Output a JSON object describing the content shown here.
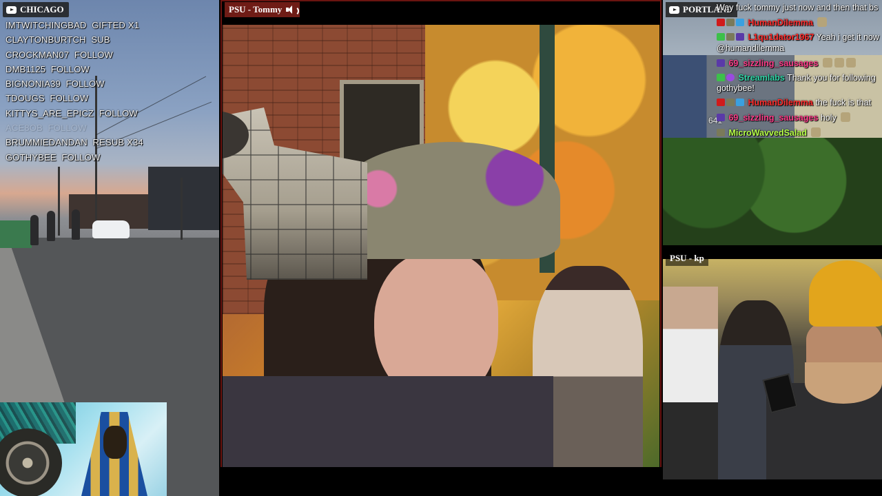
{
  "left": {
    "tag": "CHICAGO",
    "events": [
      {
        "user": "IMTWITCHINGBAD",
        "action": "GIFTED X1",
        "style": "normal"
      },
      {
        "user": "CLAYTONBURTCH",
        "action": "SUB",
        "style": "normal"
      },
      {
        "user": "CROCKMAN07",
        "action": "FOLLOW",
        "style": "normal"
      },
      {
        "user": "DMB1125",
        "action": "FOLLOW",
        "style": "normal"
      },
      {
        "user": "BIGNONIA39",
        "action": "FOLLOW",
        "style": "normal"
      },
      {
        "user": "TDOUGS",
        "action": "FOLLOW",
        "style": "normal"
      },
      {
        "user": "KITTYS_ARE_EPICZ",
        "action": "FOLLOW",
        "style": "normal"
      },
      {
        "user": "ACE8OB",
        "action": "FOLLOW",
        "style": "faded"
      },
      {
        "user": "BRUMMIEDANDAN",
        "action": "RESUB X34",
        "style": "normal"
      },
      {
        "user": "GOTHYBEE",
        "action": "FOLLOW",
        "style": "highlight"
      }
    ]
  },
  "center": {
    "tag": "PSU - Tommy"
  },
  "rtop": {
    "tag": "PORTLAND",
    "viewer_count": "641",
    "chat": [
      {
        "user": "",
        "user_color": "",
        "badges": [],
        "text": "Way fuck tommy just now and then that bs",
        "emotes": 0
      },
      {
        "user": "HumanDilemma",
        "user_color": "red",
        "badges": [
          "red",
          "sub",
          "blue"
        ],
        "text": "",
        "emotes": 1
      },
      {
        "user": "L1qu1dator1967",
        "user_color": "red",
        "badges": [
          "green",
          "sub",
          "purple"
        ],
        "text": "Yeah i get it now @humandilemma",
        "emotes": 0
      },
      {
        "user": "69_sizzling_sausages",
        "user_color": "pink",
        "badges": [
          "purple"
        ],
        "text": "",
        "emotes": 3
      },
      {
        "user": "Streamlabs",
        "user_color": "teal",
        "badges": [
          "green",
          "mod"
        ],
        "text": "Thank you for following gothybee!",
        "emotes": 0
      },
      {
        "user": "HumanDilemma",
        "user_color": "red",
        "badges": [
          "red",
          "sub",
          "blue"
        ],
        "text": "the fuck is that",
        "emotes": 0
      },
      {
        "user": "69_sizzling_sausages",
        "user_color": "pink",
        "badges": [
          "purple"
        ],
        "text": "holy",
        "emotes": 1
      },
      {
        "user": "MicroWavvedSalad",
        "user_color": "lime",
        "badges": [
          "sub"
        ],
        "text": "",
        "emotes": 1
      }
    ]
  },
  "rbot": {
    "tag": "PSU - kp"
  },
  "icons": {
    "left_tag_icon": "youtube-icon",
    "center_audio_icon": "speaker-icon",
    "right_tag_icon": "youtube-icon"
  },
  "colors": {
    "highlight": "#c8102e",
    "center_tag_bg": "#6f1c16",
    "user_red": "#ff2d2d",
    "user_pink": "#ff3d8a",
    "user_teal": "#31d6a8",
    "user_lime": "#b6ff48"
  }
}
